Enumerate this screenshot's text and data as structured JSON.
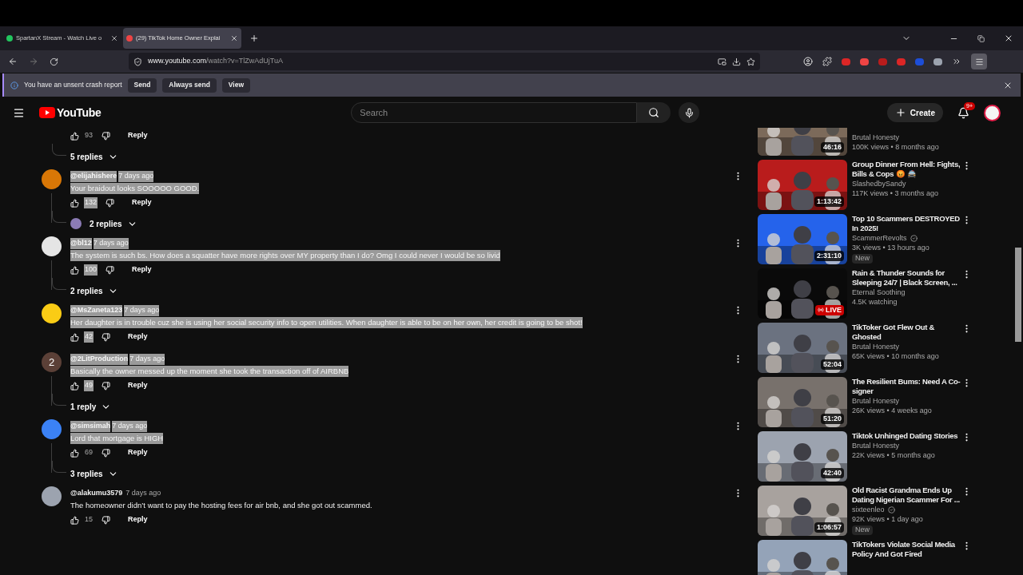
{
  "browser": {
    "tabs": [
      {
        "title": "SpartanX Stream - Watch Live o",
        "selected": false,
        "color": "#22c55e"
      },
      {
        "title": "(29) TikTok Home Owner Explai",
        "selected": true,
        "color": "#ef4444"
      }
    ],
    "url_host": "www.youtube.com",
    "url_path": "/watch?v=TlZwAdUjTuA",
    "infobar": {
      "message": "You have an unsent crash report",
      "buttons": [
        "Send",
        "Always send",
        "View"
      ]
    }
  },
  "youtube": {
    "logo": "YouTube",
    "search": {
      "placeholder": "Search"
    },
    "create": "Create",
    "notifications": "9+"
  },
  "top_fragment": {
    "likes": "93",
    "reply": "Reply",
    "replies": "5 replies"
  },
  "comments": [
    {
      "author": "@elijahishere",
      "time": "7 days ago",
      "text": "Your braidout looks SOOOOO GOOD.",
      "likes": "132",
      "reply": "Reply",
      "replies": "2 replies",
      "replies_avatar": true,
      "selected": true,
      "likes_selected": true,
      "color": "#d97706"
    },
    {
      "author": "@bl12",
      "time": "7 days ago",
      "text": "The system is such bs. How does a squatter have more rights over MY property than I do? Omg I could never I would be so livid",
      "likes": "100",
      "reply": "Reply",
      "replies": "2 replies",
      "replies_avatar": false,
      "selected": true,
      "likes_selected": true,
      "color": "#e5e5e5"
    },
    {
      "author": "@MsZaneta123",
      "time": "7 days ago",
      "text": "Her daughter is in trouble cuz she is using her social security info to open utilities. When daughter is able to be on her own, her credit is going to be shot!",
      "likes": "42",
      "reply": "Reply",
      "selected": true,
      "likes_selected": true,
      "color": "#facc15"
    },
    {
      "author": "@2LitProduction",
      "time": "7 days ago",
      "text": "Basically the owner messed up the moment she took the transaction off of AIRBNB",
      "likes": "49",
      "reply": "Reply",
      "replies": "1 reply",
      "replies_avatar": false,
      "selected": true,
      "likes_selected": true,
      "color": "#5b4037",
      "letter": "2"
    },
    {
      "author": "@simsimah",
      "time": "7 days ago",
      "text": "Lord that mortgage is HIGH",
      "likes": "69",
      "reply": "Reply",
      "replies": "3 replies",
      "replies_avatar": false,
      "selected": true,
      "likes_selected": false,
      "color": "#3b82f6"
    },
    {
      "author": "@alakumu3579",
      "time": "7 days ago",
      "text": "The homeowner didn’t want to pay the hosting fees for air bnb, and she got out scammed.",
      "likes": "15",
      "reply": "Reply",
      "selected": false,
      "likes_selected": false,
      "color": "#9ca3af"
    }
  ],
  "videos": [
    {
      "channel": "Brutal Honesty",
      "meta": "100K views • 8 months ago",
      "duration": "46:16"
    },
    {
      "title": "Group Dinner From Hell: Fights, Bills & Cops 😡 🚔",
      "channel": "SlashedbySandy",
      "meta": "117K views • 3 months ago",
      "duration": "1:13:42",
      "verified": false
    },
    {
      "title": "Top 10 Scammers DESTROYED In 2025!",
      "channel": "ScammerRevolts",
      "verified": true,
      "meta": "3K views • 13 hours ago",
      "badge": "New",
      "duration": "2:31:10"
    },
    {
      "title": "Rain & Thunder Sounds for Sleeping 24/7 | Black Screen, ...",
      "channel": "Eternal Soothing",
      "meta": "4.5K watching",
      "live": "LIVE",
      "verified": false
    },
    {
      "title": "TikToker Got Flew Out & Ghosted",
      "channel": "Brutal Honesty",
      "meta": "65K views • 10 months ago",
      "duration": "52:04",
      "verified": false
    },
    {
      "title": "The Resilient Bums: Need A Co-signer",
      "channel": "Brutal Honesty",
      "meta": "26K views • 4 weeks ago",
      "duration": "51:20",
      "verified": false
    },
    {
      "title": "Tiktok Unhinged Dating Stories",
      "channel": "Brutal Honesty",
      "meta": "22K views • 5 months ago",
      "duration": "42:40",
      "verified": false
    },
    {
      "title": "Old Racist Grandma Ends Up Dating Nigerian Scammer For ...",
      "channel": "sixteenleo",
      "verified": true,
      "meta": "92K views • 1 day ago",
      "badge": "New",
      "duration": "1:06:57"
    },
    {
      "title": "TikTokers Violate Social Media Policy And Got Fired"
    }
  ]
}
